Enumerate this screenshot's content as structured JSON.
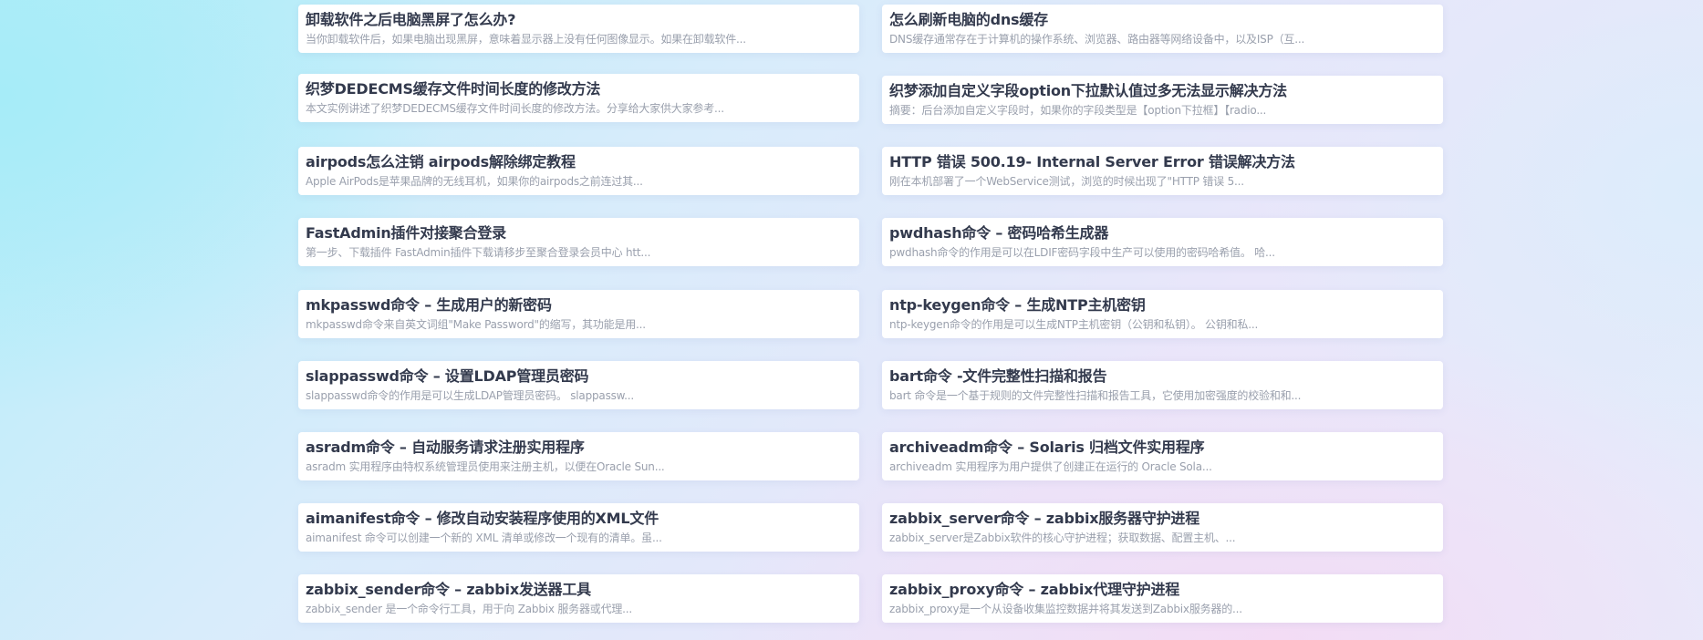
{
  "articles": [
    {
      "title": "卸载软件之后电脑黑屏了怎么办?",
      "desc": "当你卸载软件后，如果电脑出现黑屏，意味着显示器上没有任何图像显示。如果在卸载软件..."
    },
    {
      "title": "怎么刷新电脑的dns缓存",
      "desc": "DNS缓存通常存在于计算机的操作系统、浏览器、路由器等网络设备中，以及ISP（互..."
    },
    {
      "title": "织梦DEDECMS缓存文件时间长度的修改方法",
      "desc": "本文实例讲述了织梦DEDECMS缓存文件时间长度的修改方法。分享给大家供大家参考..."
    },
    {
      "title": "织梦添加自定义字段option下拉默认值过多无法显示解决方法",
      "desc": "摘要：后台添加自定义字段时，如果你的字段类型是【option下拉框】【radio..."
    },
    {
      "title": "airpods怎么注销 airpods解除绑定教程",
      "desc": "Apple AirPods是苹果品牌的无线耳机，如果你的airpods之前连过其..."
    },
    {
      "title": "HTTP 错误 500.19- Internal Server Error 错误解决方法",
      "desc": "刚在本机部署了一个WebService测试，浏览的时候出现了\"HTTP 错误 5..."
    },
    {
      "title": "FastAdmin插件对接聚合登录",
      "desc": "第一步、下载插件  FastAdmin插件下载请移步至聚合登录会员中心  htt..."
    },
    {
      "title": "pwdhash命令 – 密码哈希生成器",
      "desc": "pwdhash命令的作用是可以在LDIF密码字段中生产可以使用的密码哈希值。 哈..."
    },
    {
      "title": "mkpasswd命令 – 生成用户的新密码",
      "desc": "mkpasswd命令来自英文词组\"Make Password\"的缩写，其功能是用..."
    },
    {
      "title": "ntp-keygen命令 – 生成NTP主机密钥",
      "desc": "ntp-keygen命令的作用是可以生成NTP主机密钥（公钥和私钥）。 公钥和私..."
    },
    {
      "title": "slappasswd命令 – 设置LDAP管理员密码",
      "desc": "slappasswd命令的作用是可以生成LDAP管理员密码。 slappassw..."
    },
    {
      "title": "bart命令 -文件完整性扫描和报告",
      "desc": "bart 命令是一个基于规则的文件完整性扫描和报告工具，它使用加密强度的校验和和..."
    },
    {
      "title": "asradm命令 – 自动服务请求注册实用程序",
      "desc": "asradm 实用程序由特权系统管理员使用来注册主机，以便在Oracle Sun..."
    },
    {
      "title": "archiveadm命令 – Solaris 归档文件实用程序",
      "desc": "archiveadm 实用程序为用户提供了创建正在运行的 Oracle Sola..."
    },
    {
      "title": "aimanifest命令 – 修改自动安装程序使用的XML文件",
      "desc": "aimanifest 命令可以创建一个新的 XML 清单或修改一个现有的清单。虽..."
    },
    {
      "title": "zabbix_server命令 – zabbix服务器守护进程",
      "desc": "zabbix_server是Zabbix软件的核心守护进程；获取数据、配置主机、..."
    },
    {
      "title": "zabbix_sender命令 – zabbix发送器工具",
      "desc": "zabbix_sender 是一个命令行工具，用于向 Zabbix 服务器或代理..."
    },
    {
      "title": "zabbix_proxy命令 – zabbix代理守护进程",
      "desc": "zabbix_proxy是一个从设备收集监控数据并将其发送到Zabbix服务器的..."
    }
  ]
}
